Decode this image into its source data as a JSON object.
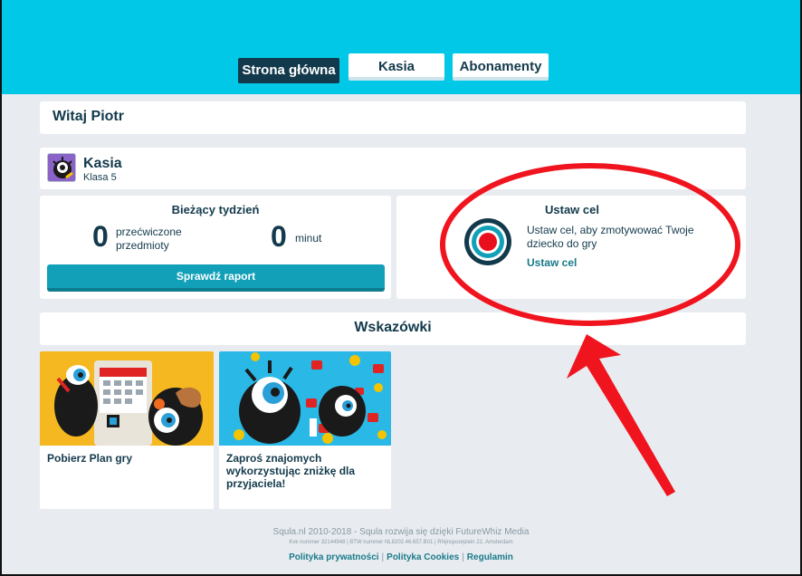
{
  "nav": {
    "tabs": [
      {
        "label": "Strona główna",
        "active": true
      },
      {
        "label": "Kasia",
        "active": false
      },
      {
        "label": "Abonamenty",
        "active": false
      }
    ]
  },
  "welcome": {
    "text": "Witaj Piotr"
  },
  "child": {
    "name": "Kasia",
    "class": "Klasa 5"
  },
  "week": {
    "title": "Bieżący tydzień",
    "subjects_count": "0",
    "subjects_label_1": "przećwiczone",
    "subjects_label_2": "przedmioty",
    "minutes_count": "0",
    "minutes_label": "minut",
    "report_button": "Sprawdź raport"
  },
  "goal": {
    "title": "Ustaw cel",
    "text": "Ustaw cel, aby zmotywować Twoje dziecko do gry",
    "link": "Ustaw cel"
  },
  "tips": {
    "title": "Wskazówki",
    "cards": [
      {
        "text": "Pobierz Plan gry"
      },
      {
        "text": "Zaproś znajomych wykorzystując zniżkę dla przyjaciela!"
      }
    ]
  },
  "footer": {
    "line1": "Squla.nl 2010-2018 - Squla rozwija się dzięki FutureWhiz Media",
    "line2": "Kvk nummer 32144948 | BTW nummer NL8202.46.657.B01 | Rhijnspoorplein 22, Amsterdam",
    "links": [
      "Polityka prywatności",
      "Polityka Cookies",
      "Regulamin"
    ]
  },
  "colors": {
    "accent": "#00c8e6",
    "navy": "#133a4c",
    "button": "#12a0b8",
    "annotation": "#f0141e"
  }
}
